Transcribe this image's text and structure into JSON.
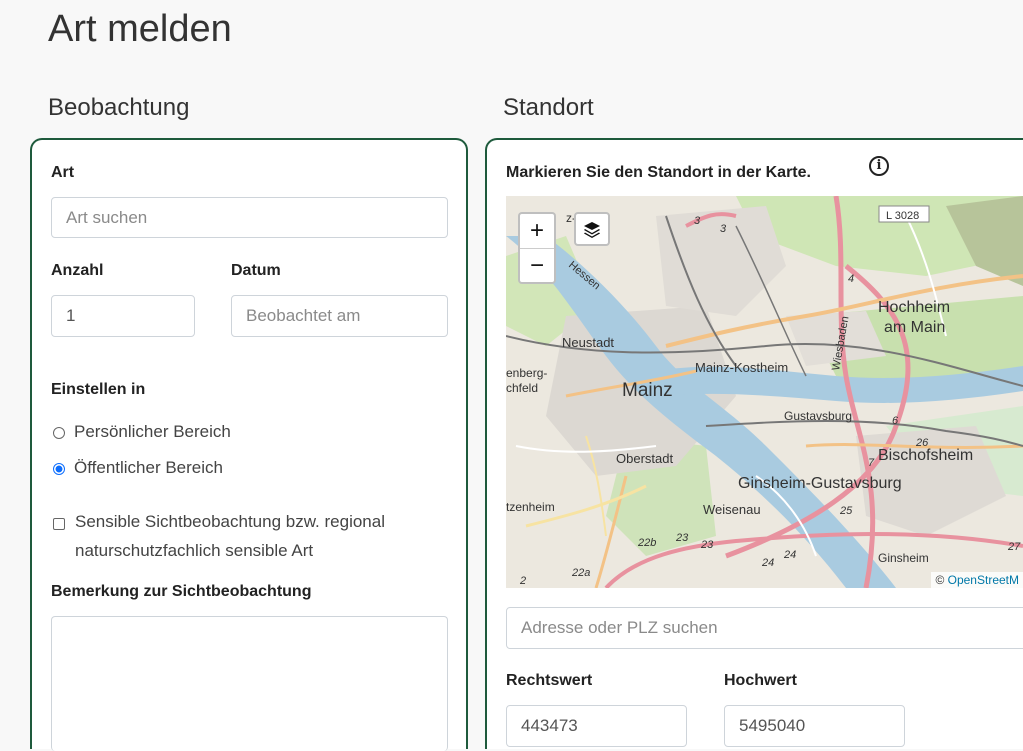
{
  "page": {
    "title": "Art melden"
  },
  "observation": {
    "section_title": "Beobachtung",
    "species_label": "Art",
    "species_placeholder": "Art suchen",
    "count_label": "Anzahl",
    "count_value": "1",
    "date_label": "Datum",
    "date_placeholder": "Beobachtet am",
    "publish_label": "Einstellen in",
    "radio_private": "Persönlicher Bereich",
    "radio_public": "Öffentlicher Bereich",
    "selected_option": "Öffentlicher Bereich",
    "sensitive_line1": "Sensible Sichtbeobachtung bzw. regional",
    "sensitive_line2": "naturschutzfachlich sensible Art",
    "remark_label": "Bemerkung zur Sichtbeobachtung"
  },
  "location": {
    "section_title": "Standort",
    "instruction": "Markieren Sie den Standort in der Karte.",
    "address_placeholder": "Adresse oder PLZ suchen",
    "easting_label": "Rechtswert",
    "easting_value": "443473",
    "northing_label": "Hochwert",
    "northing_value": "5495040"
  },
  "map": {
    "zoom_in": "+",
    "zoom_out": "−",
    "attribution_prefix": "©",
    "attribution_link": "OpenStreetM",
    "labels": {
      "l3028": "L 3028",
      "burg": "z-A  burg",
      "hessen": "Hessen",
      "hochheim1": "Hochheim",
      "hochheim2": "am Main",
      "neustadt": "Neustadt",
      "enberg": "enberg-",
      "chfeld": "chfeld",
      "mainz": "Mainz",
      "kostheim": "Mainz-Kostheim",
      "wiesbaden": "Wiesbaden",
      "gustavsburg": "Gustavsburg",
      "bischofsheim": "Bischofsheim",
      "oberstadt": "Oberstadt",
      "ginsheim_gustavsburg": "Ginsheim-Gustavsburg",
      "tzenheim": "tzenheim",
      "weisenau": "Weisenau",
      "ginsheim": "Ginsheim",
      "r22b": "22b",
      "r23a": "23",
      "r23b": "23",
      "r24a": "24",
      "r24b": "24",
      "r25": "25",
      "r26": "26",
      "r27": "27",
      "r22a": "22a",
      "r3a": "3",
      "r3b": "3",
      "r4": "4",
      "r6": "6",
      "r7": "7",
      "r2": "2"
    }
  }
}
